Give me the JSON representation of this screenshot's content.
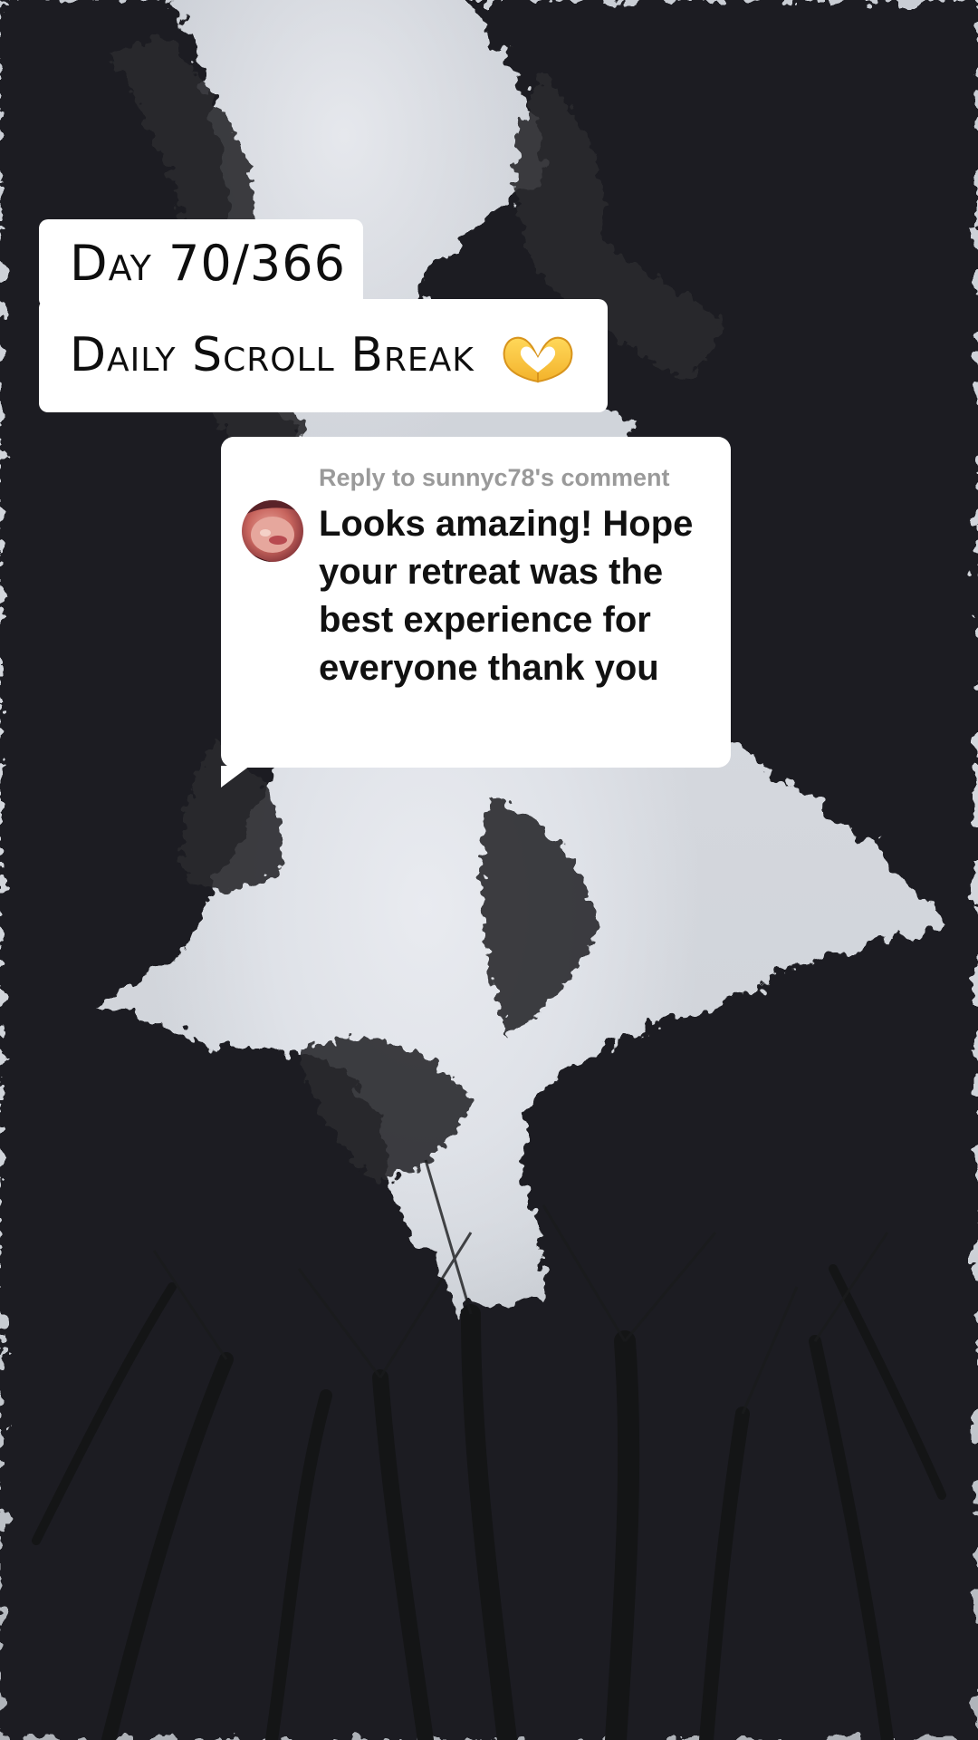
{
  "overlay": {
    "day_counter": "Day 70/366",
    "title": "Daily Scroll Break",
    "title_emoji": "heart-hands-emoji"
  },
  "reply": {
    "reply_to": "Reply to sunnyc78's comment",
    "comment": "Looks amazing! Hope your retreat was the best experience for everyone thank you",
    "avatar": "commenter-avatar"
  },
  "colors": {
    "sticker_bg": "#ffffff",
    "text_dark": "#111111",
    "reply_label": "#9a9a9a",
    "sky": "#dfe2e8",
    "canopy": "#1c1d1f"
  }
}
